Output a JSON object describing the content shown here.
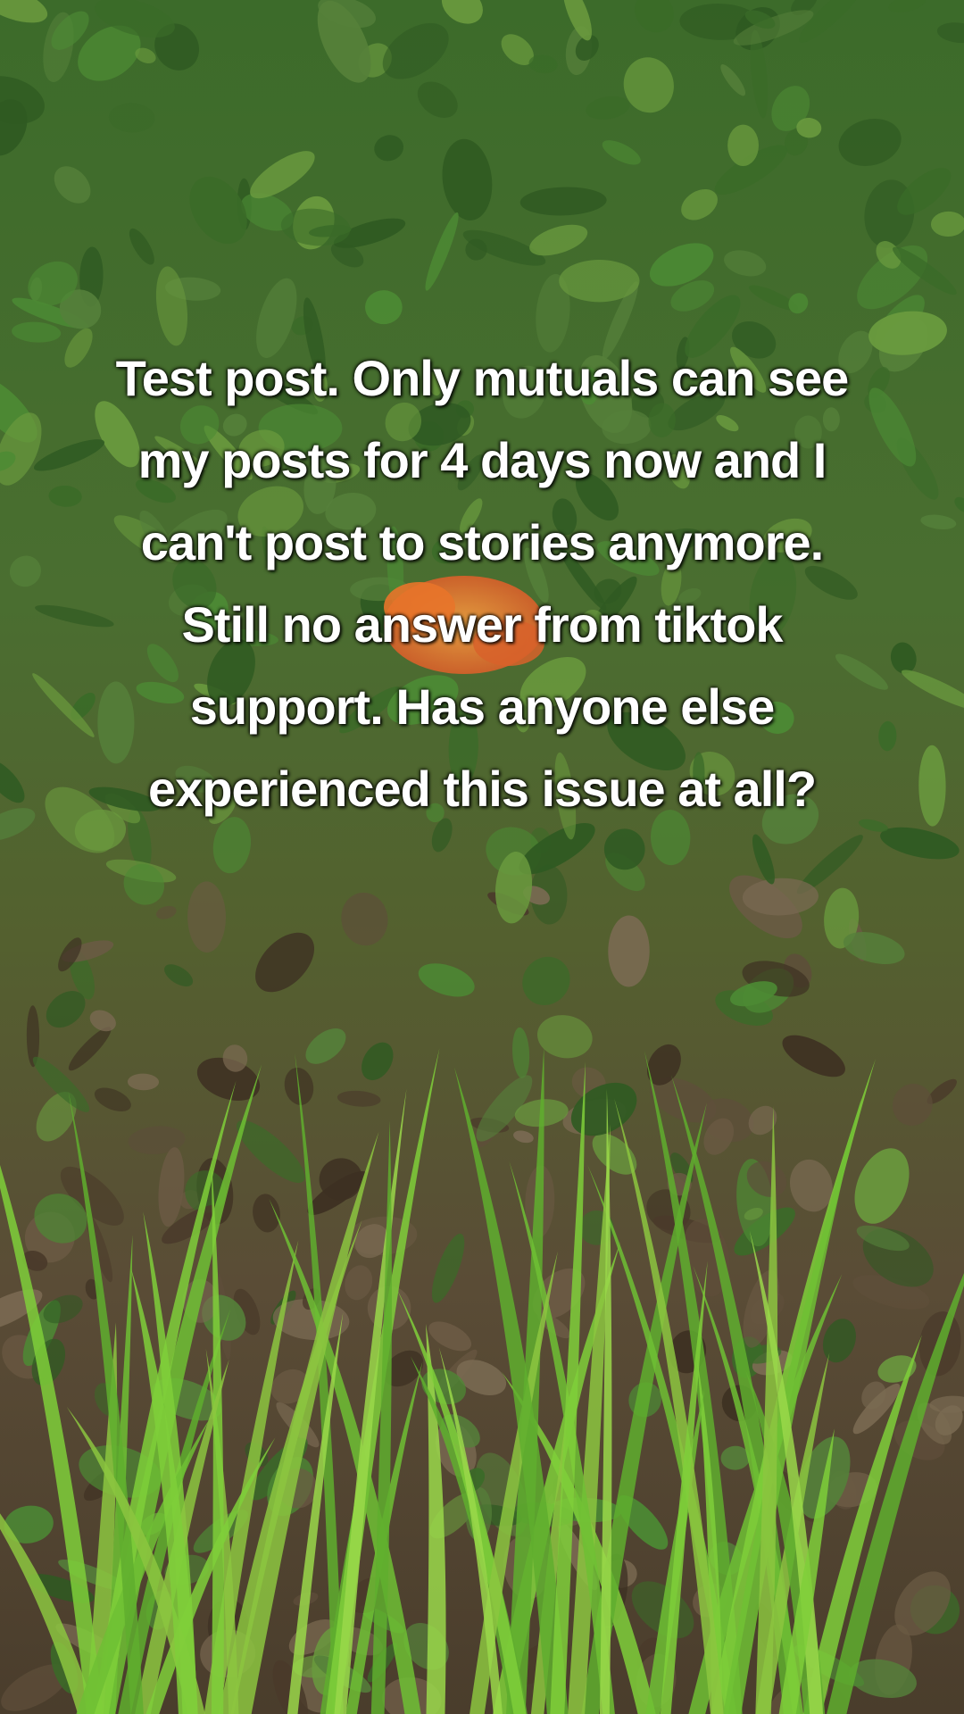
{
  "caption": {
    "lines": [
      "Test post. Only mutuals can see",
      "my posts for 4 days now and I",
      "can't post to stories anymore.",
      "Still no answer from tiktok",
      "support. Has anyone else",
      "experienced this issue at all?"
    ]
  },
  "scene": {
    "colors": {
      "foliage_top": "#3f6e2a",
      "foliage_mid": "#4e6a33",
      "leaf_litter": "#5b4a35",
      "grass_bright": "#7fcf3a",
      "lily_orange": "#e8742a"
    }
  }
}
